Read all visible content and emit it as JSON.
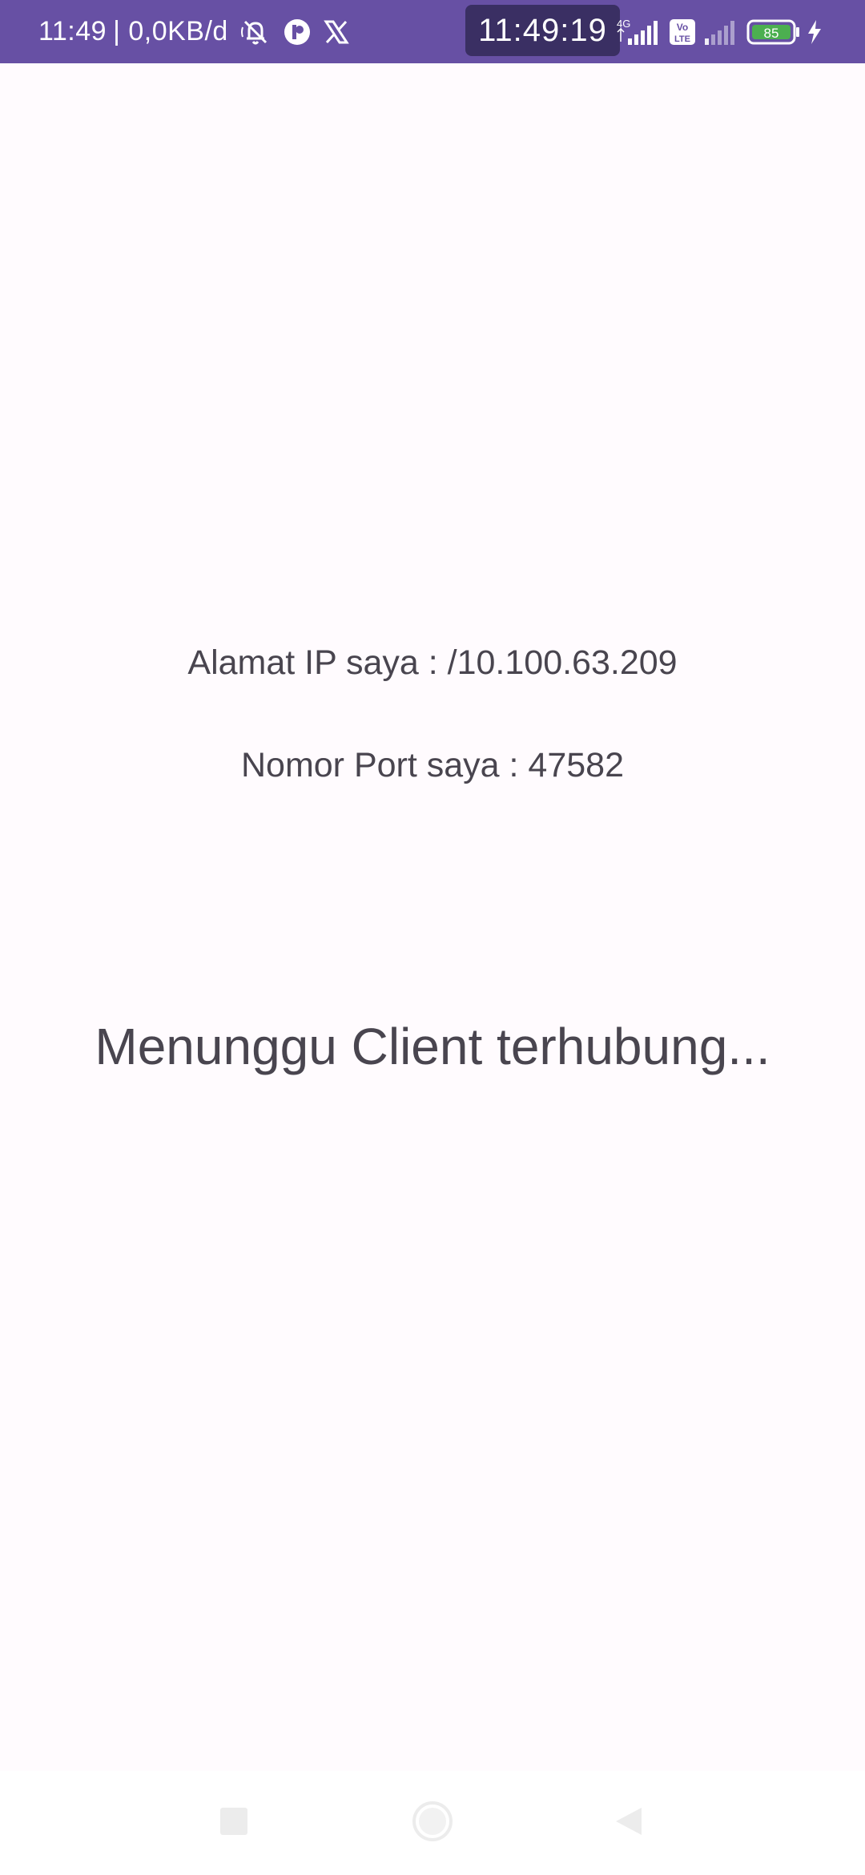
{
  "status_bar": {
    "time": "11:49",
    "data_speed": "| 0,0KB/d",
    "clock_overlay": "11:49:19",
    "network_type": "4G",
    "volte_label_top": "Vo",
    "volte_label_bottom": "LTE",
    "battery_level": "85",
    "icons": [
      "muted-bell-icon",
      "app-notification-icon",
      "x-app-icon",
      "signal-icon",
      "volte-icon",
      "battery-icon",
      "charging-icon"
    ],
    "background_color": "#6750a4"
  },
  "main": {
    "ip_line": "Alamat IP saya : /10.100.63.209",
    "port_line": "Nomor Port saya : 47582",
    "status_message": "Menunggu Client terhubung...",
    "text_color": "#49454f"
  },
  "nav_bar": {
    "icons": [
      "recents-square-icon",
      "home-circle-icon",
      "back-triangle-icon"
    ]
  }
}
